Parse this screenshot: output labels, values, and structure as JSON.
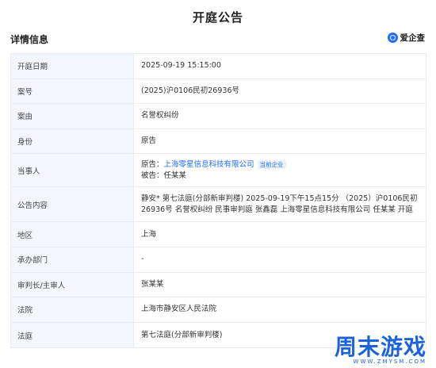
{
  "page_title": "开庭公告",
  "section_title": "详情信息",
  "brand": {
    "name": "爱企查",
    "icon": "aiqicha-logo-icon"
  },
  "rows": [
    {
      "label": "开庭日期",
      "value": "2025-09-19 15:15:00"
    },
    {
      "label": "案号",
      "value": "(2025)沪0106民初26936号"
    },
    {
      "label": "案由",
      "value": "名誉权纠纷"
    },
    {
      "label": "身份",
      "value": "原告"
    },
    {
      "label": "当事人",
      "plaintiff_prefix": "原告：",
      "plaintiff_name": "上海零星信息科技有限公司",
      "plaintiff_tag": "当前企业",
      "defendant_prefix": "被告：",
      "defendant_name": "任某某"
    },
    {
      "label": "公告内容",
      "value": "静安* 第七法庭(分部新审判楼) 2025-09-19下午15点15分 （2025）沪0106民初26936号 名誉权纠纷 民事审判庭 张鑫磊 上海零星信息科技有限公司 任某某 开庭"
    },
    {
      "label": "地区",
      "value": "上海"
    },
    {
      "label": "承办部门",
      "value": "-"
    },
    {
      "label": "审判长/主审人",
      "value": "张某某"
    },
    {
      "label": "法院",
      "value": "上海市静安区人民法院"
    },
    {
      "label": "法庭",
      "value": "第七法庭(分部新审判楼)"
    }
  ],
  "watermark": {
    "title": "周末游戏",
    "subtitle": "WWW.ZMYSM.COM"
  }
}
